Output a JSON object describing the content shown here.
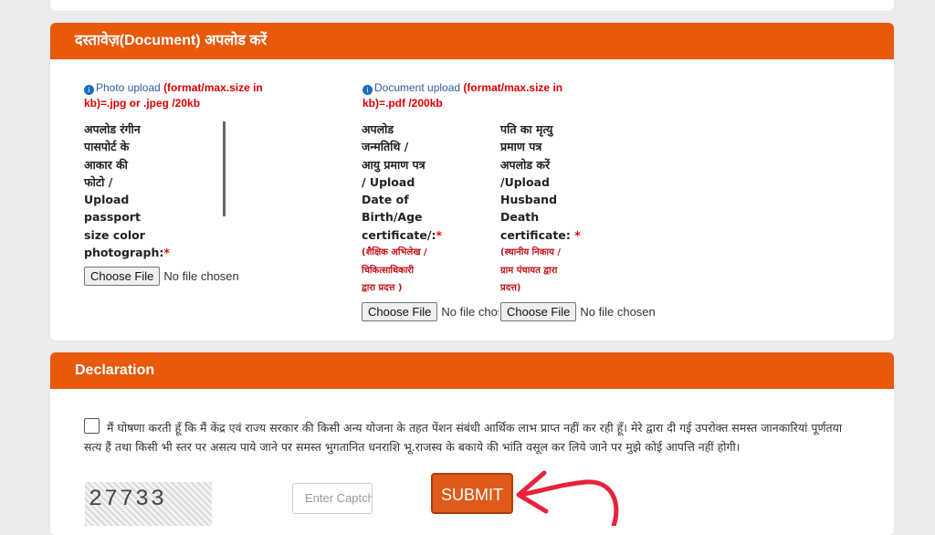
{
  "document_section": {
    "header": "दस्तावेज़(Document) अपलोड करें",
    "photo_upload": {
      "title": "Photo upload ",
      "format": "(format/max.size in kb)=.jpg or .jpeg /20kb",
      "label_lines": [
        "अपलोड रंगीन",
        "पासपोर्ट के",
        "आकार की",
        "फोटो /",
        "Upload",
        "passport",
        "size color",
        "photograph:"
      ],
      "required_mark": "*",
      "button": "Choose File",
      "status": "No file chosen"
    },
    "document_upload": {
      "title": "Document upload ",
      "format": "(format/max.size in kb)=.pdf /200kb"
    },
    "dob_upload": {
      "label_lines": [
        "अपलोड",
        "जन्मतिथि /",
        "आयु प्रमाण पत्र",
        "/ Upload",
        "Date of",
        "Birth/Age",
        "certificate/:"
      ],
      "required_mark": "*",
      "note_lines": [
        "(शैक्षिक अभिलेख /",
        "चिकित्साधिकारी",
        "द्वारा प्रदत्त )"
      ],
      "button": "Choose File",
      "status": "No file chosen"
    },
    "death_upload": {
      "label_lines": [
        "पति का मृत्यु",
        "प्रमाण पत्र",
        "अपलोड करें",
        "/Upload",
        "Husband",
        "Death",
        "certificate: "
      ],
      "required_mark": "*",
      "note_lines": [
        "(स्थानीय निकाय /",
        "ग्राम पंचायत द्वारा",
        "प्रदत्त)"
      ],
      "button": "Choose File",
      "status": "No file chosen"
    }
  },
  "declaration_section": {
    "header": "Declaration",
    "text": "मैं घोषणा करती हूँ कि मैं केंद्र एवं राज्य सरकार की किसी अन्य योजना के तहत पेंशन संबंधी आर्थिक लाभ प्राप्त नहीं कर रही हूँ। मेरे द्वारा दी गई उपरोक्त समस्त जानकारियां पूर्णतया सत्य हैं तथा किसी भी स्तर पर असत्य पाये जाने पर समस्त भुगतानित धनराशि भू.राजस्व के बकाये की भांति वसूल कर लिये जाने पर मुझे कोई आपत्ति नहीं होगी।",
    "captcha_text": "27733",
    "captcha_placeholder": "Enter Captcha",
    "submit": "SUBMIT"
  },
  "colors": {
    "header_bg": "#e8590c",
    "submit_bg": "#e05a19",
    "arrow": "#e8223c",
    "required": "#e00000"
  }
}
